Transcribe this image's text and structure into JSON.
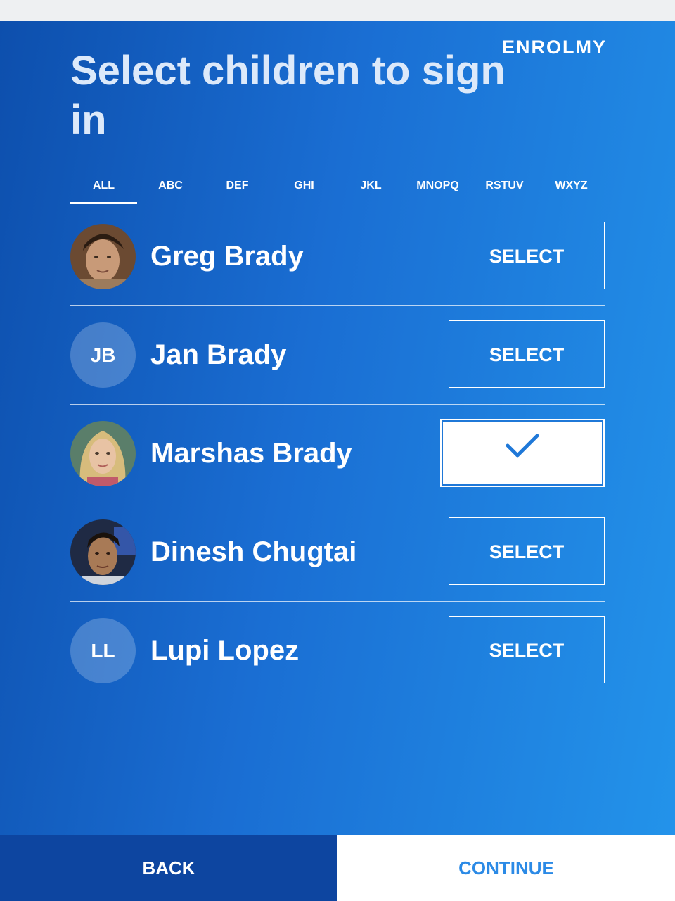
{
  "brand": {
    "logo_text": "ENROLMY"
  },
  "page": {
    "title": "Select children to sign in"
  },
  "tabs": [
    {
      "label": "ALL",
      "active": true
    },
    {
      "label": "ABC",
      "active": false
    },
    {
      "label": "DEF",
      "active": false
    },
    {
      "label": "GHI",
      "active": false
    },
    {
      "label": "JKL",
      "active": false
    },
    {
      "label": "MNOPQ",
      "active": false
    },
    {
      "label": "RSTUV",
      "active": false
    },
    {
      "label": "WXYZ",
      "active": false
    }
  ],
  "children": [
    {
      "name": "Greg Brady",
      "avatar": "photo",
      "initials": "",
      "select_label": "SELECT",
      "selected": false
    },
    {
      "name": "Jan Brady",
      "avatar": "initials",
      "initials": "JB",
      "select_label": "SELECT",
      "selected": false
    },
    {
      "name": "Marshas Brady",
      "avatar": "photo",
      "initials": "",
      "select_label": "",
      "selected": true,
      "selected_icon": "checkmark-icon"
    },
    {
      "name": "Dinesh Chugtai",
      "avatar": "photo",
      "initials": "",
      "select_label": "SELECT",
      "selected": false
    },
    {
      "name": "Lupi Lopez",
      "avatar": "initials",
      "initials": "LL",
      "select_label": "SELECT",
      "selected": false
    }
  ],
  "footer": {
    "back_label": "BACK",
    "continue_label": "CONTINUE"
  },
  "colors": {
    "accent": "#2b8ae6",
    "back_bg": "#0d45a0",
    "gradient_start": "#0d4fad",
    "gradient_end": "#2393ea"
  }
}
